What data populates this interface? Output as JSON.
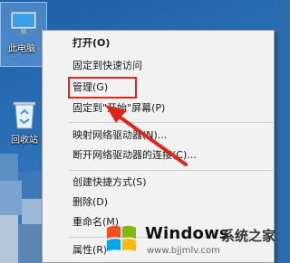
{
  "desktop": {
    "icons": [
      {
        "label": "此电脑",
        "icon": "computer-icon"
      },
      {
        "label": "回收站",
        "icon": "recycle-bin-icon"
      }
    ]
  },
  "context_menu": {
    "items": [
      {
        "label": "打开(O)",
        "bold": true
      },
      {
        "label": "固定到快速访问"
      },
      {
        "label": "管理(G)"
      },
      {
        "label": "固定到\"开始\"屏幕(P)"
      },
      {
        "label": "映射网络驱动器(N)..."
      },
      {
        "label": "断开网络驱动器的连接(C)..."
      },
      {
        "label": "创建快捷方式(S)"
      },
      {
        "label": "删除(D)"
      },
      {
        "label": "重命名(M)"
      },
      {
        "label": "属性(R)"
      }
    ]
  },
  "watermark": {
    "brand": "Windows",
    "site_name": "系统之家",
    "url": "www.bjjmlv.com",
    "logo": "windows-logo-icon"
  },
  "colors": {
    "highlight": "#e0261b",
    "menu_bg": "#f2f2f2",
    "desktop_bg": "#2a6fb6"
  }
}
